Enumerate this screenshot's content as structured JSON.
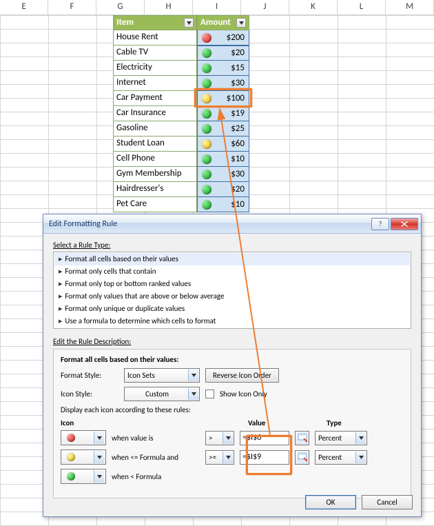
{
  "columns": [
    "E",
    "F",
    "G",
    "H",
    "I",
    "J",
    "K",
    "L",
    "M"
  ],
  "table": {
    "headers": {
      "item": "Item",
      "amount": "Amount"
    },
    "rows": [
      {
        "item": "House Rent",
        "amount": "$200",
        "icon": "red"
      },
      {
        "item": "Cable TV",
        "amount": "$20",
        "icon": "green"
      },
      {
        "item": "Electricity",
        "amount": "$15",
        "icon": "green"
      },
      {
        "item": "Internet",
        "amount": "$30",
        "icon": "green"
      },
      {
        "item": "Car Payment",
        "amount": "$100",
        "icon": "yellow",
        "selected": true
      },
      {
        "item": "Car Insurance",
        "amount": "$19",
        "icon": "green"
      },
      {
        "item": "Gasoline",
        "amount": "$25",
        "icon": "green"
      },
      {
        "item": "Student Loan",
        "amount": "$60",
        "icon": "yellow"
      },
      {
        "item": "Cell Phone",
        "amount": "$10",
        "icon": "green"
      },
      {
        "item": "Gym Membership",
        "amount": "$30",
        "icon": "green"
      },
      {
        "item": "Hairdresser's",
        "amount": "$20",
        "icon": "green"
      },
      {
        "item": "Pet Care",
        "amount": "$10",
        "icon": "green"
      }
    ]
  },
  "dialog": {
    "title": "Edit Formatting Rule",
    "select_label": "Select a Rule Type:",
    "rule_types": [
      "Format all cells based on their values",
      "Format only cells that contain",
      "Format only top or bottom ranked values",
      "Format only values that are above or below average",
      "Format only unique or duplicate values",
      "Use a formula to determine which cells to format"
    ],
    "edit_label": "Edit the Rule Description:",
    "desc_header": "Format all cells based on their values:",
    "format_style_label": "Format Style:",
    "format_style_value": "Icon Sets",
    "reverse_btn": "Reverse Icon Order",
    "icon_style_label": "Icon Style:",
    "icon_style_value": "Custom",
    "show_icon_only": "Show Icon Only",
    "display_label": "Display each icon according to these rules:",
    "col_icon": "Icon",
    "col_value": "Value",
    "col_type": "Type",
    "rules": [
      {
        "icon": "red",
        "when": "when value is",
        "op": ">",
        "value": "=$I$6",
        "type": "Percent"
      },
      {
        "icon": "yellow",
        "when": "when <= Formula and",
        "op": ">=",
        "value": "=$I$9",
        "type": "Percent"
      },
      {
        "icon": "green",
        "when": "when < Formula",
        "op": "",
        "value": "",
        "type": ""
      }
    ],
    "ok": "OK",
    "cancel": "Cancel"
  }
}
